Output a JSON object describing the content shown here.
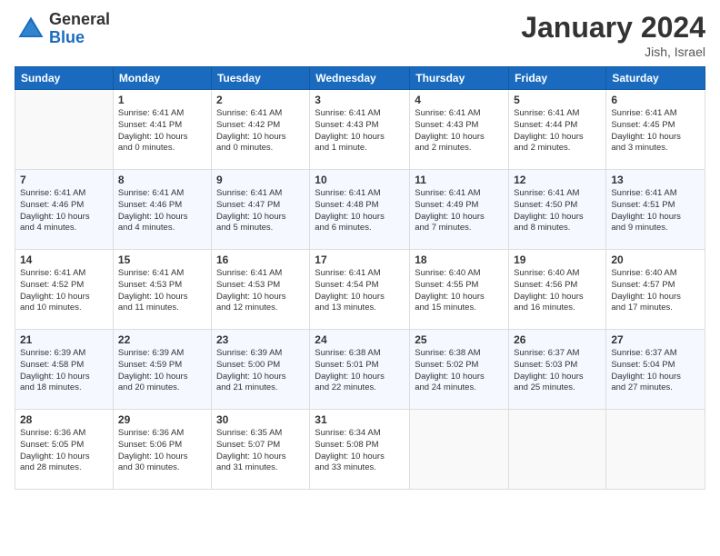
{
  "header": {
    "logo_general": "General",
    "logo_blue": "Blue",
    "month_title": "January 2024",
    "location": "Jish, Israel"
  },
  "days_of_week": [
    "Sunday",
    "Monday",
    "Tuesday",
    "Wednesday",
    "Thursday",
    "Friday",
    "Saturday"
  ],
  "weeks": [
    [
      {
        "day": "",
        "info": ""
      },
      {
        "day": "1",
        "info": "Sunrise: 6:41 AM\nSunset: 4:41 PM\nDaylight: 10 hours\nand 0 minutes."
      },
      {
        "day": "2",
        "info": "Sunrise: 6:41 AM\nSunset: 4:42 PM\nDaylight: 10 hours\nand 0 minutes."
      },
      {
        "day": "3",
        "info": "Sunrise: 6:41 AM\nSunset: 4:43 PM\nDaylight: 10 hours\nand 1 minute."
      },
      {
        "day": "4",
        "info": "Sunrise: 6:41 AM\nSunset: 4:43 PM\nDaylight: 10 hours\nand 2 minutes."
      },
      {
        "day": "5",
        "info": "Sunrise: 6:41 AM\nSunset: 4:44 PM\nDaylight: 10 hours\nand 2 minutes."
      },
      {
        "day": "6",
        "info": "Sunrise: 6:41 AM\nSunset: 4:45 PM\nDaylight: 10 hours\nand 3 minutes."
      }
    ],
    [
      {
        "day": "7",
        "info": "Sunrise: 6:41 AM\nSunset: 4:46 PM\nDaylight: 10 hours\nand 4 minutes."
      },
      {
        "day": "8",
        "info": "Sunrise: 6:41 AM\nSunset: 4:46 PM\nDaylight: 10 hours\nand 4 minutes."
      },
      {
        "day": "9",
        "info": "Sunrise: 6:41 AM\nSunset: 4:47 PM\nDaylight: 10 hours\nand 5 minutes."
      },
      {
        "day": "10",
        "info": "Sunrise: 6:41 AM\nSunset: 4:48 PM\nDaylight: 10 hours\nand 6 minutes."
      },
      {
        "day": "11",
        "info": "Sunrise: 6:41 AM\nSunset: 4:49 PM\nDaylight: 10 hours\nand 7 minutes."
      },
      {
        "day": "12",
        "info": "Sunrise: 6:41 AM\nSunset: 4:50 PM\nDaylight: 10 hours\nand 8 minutes."
      },
      {
        "day": "13",
        "info": "Sunrise: 6:41 AM\nSunset: 4:51 PM\nDaylight: 10 hours\nand 9 minutes."
      }
    ],
    [
      {
        "day": "14",
        "info": "Sunrise: 6:41 AM\nSunset: 4:52 PM\nDaylight: 10 hours\nand 10 minutes."
      },
      {
        "day": "15",
        "info": "Sunrise: 6:41 AM\nSunset: 4:53 PM\nDaylight: 10 hours\nand 11 minutes."
      },
      {
        "day": "16",
        "info": "Sunrise: 6:41 AM\nSunset: 4:53 PM\nDaylight: 10 hours\nand 12 minutes."
      },
      {
        "day": "17",
        "info": "Sunrise: 6:41 AM\nSunset: 4:54 PM\nDaylight: 10 hours\nand 13 minutes."
      },
      {
        "day": "18",
        "info": "Sunrise: 6:40 AM\nSunset: 4:55 PM\nDaylight: 10 hours\nand 15 minutes."
      },
      {
        "day": "19",
        "info": "Sunrise: 6:40 AM\nSunset: 4:56 PM\nDaylight: 10 hours\nand 16 minutes."
      },
      {
        "day": "20",
        "info": "Sunrise: 6:40 AM\nSunset: 4:57 PM\nDaylight: 10 hours\nand 17 minutes."
      }
    ],
    [
      {
        "day": "21",
        "info": "Sunrise: 6:39 AM\nSunset: 4:58 PM\nDaylight: 10 hours\nand 18 minutes."
      },
      {
        "day": "22",
        "info": "Sunrise: 6:39 AM\nSunset: 4:59 PM\nDaylight: 10 hours\nand 20 minutes."
      },
      {
        "day": "23",
        "info": "Sunrise: 6:39 AM\nSunset: 5:00 PM\nDaylight: 10 hours\nand 21 minutes."
      },
      {
        "day": "24",
        "info": "Sunrise: 6:38 AM\nSunset: 5:01 PM\nDaylight: 10 hours\nand 22 minutes."
      },
      {
        "day": "25",
        "info": "Sunrise: 6:38 AM\nSunset: 5:02 PM\nDaylight: 10 hours\nand 24 minutes."
      },
      {
        "day": "26",
        "info": "Sunrise: 6:37 AM\nSunset: 5:03 PM\nDaylight: 10 hours\nand 25 minutes."
      },
      {
        "day": "27",
        "info": "Sunrise: 6:37 AM\nSunset: 5:04 PM\nDaylight: 10 hours\nand 27 minutes."
      }
    ],
    [
      {
        "day": "28",
        "info": "Sunrise: 6:36 AM\nSunset: 5:05 PM\nDaylight: 10 hours\nand 28 minutes."
      },
      {
        "day": "29",
        "info": "Sunrise: 6:36 AM\nSunset: 5:06 PM\nDaylight: 10 hours\nand 30 minutes."
      },
      {
        "day": "30",
        "info": "Sunrise: 6:35 AM\nSunset: 5:07 PM\nDaylight: 10 hours\nand 31 minutes."
      },
      {
        "day": "31",
        "info": "Sunrise: 6:34 AM\nSunset: 5:08 PM\nDaylight: 10 hours\nand 33 minutes."
      },
      {
        "day": "",
        "info": ""
      },
      {
        "day": "",
        "info": ""
      },
      {
        "day": "",
        "info": ""
      }
    ]
  ]
}
